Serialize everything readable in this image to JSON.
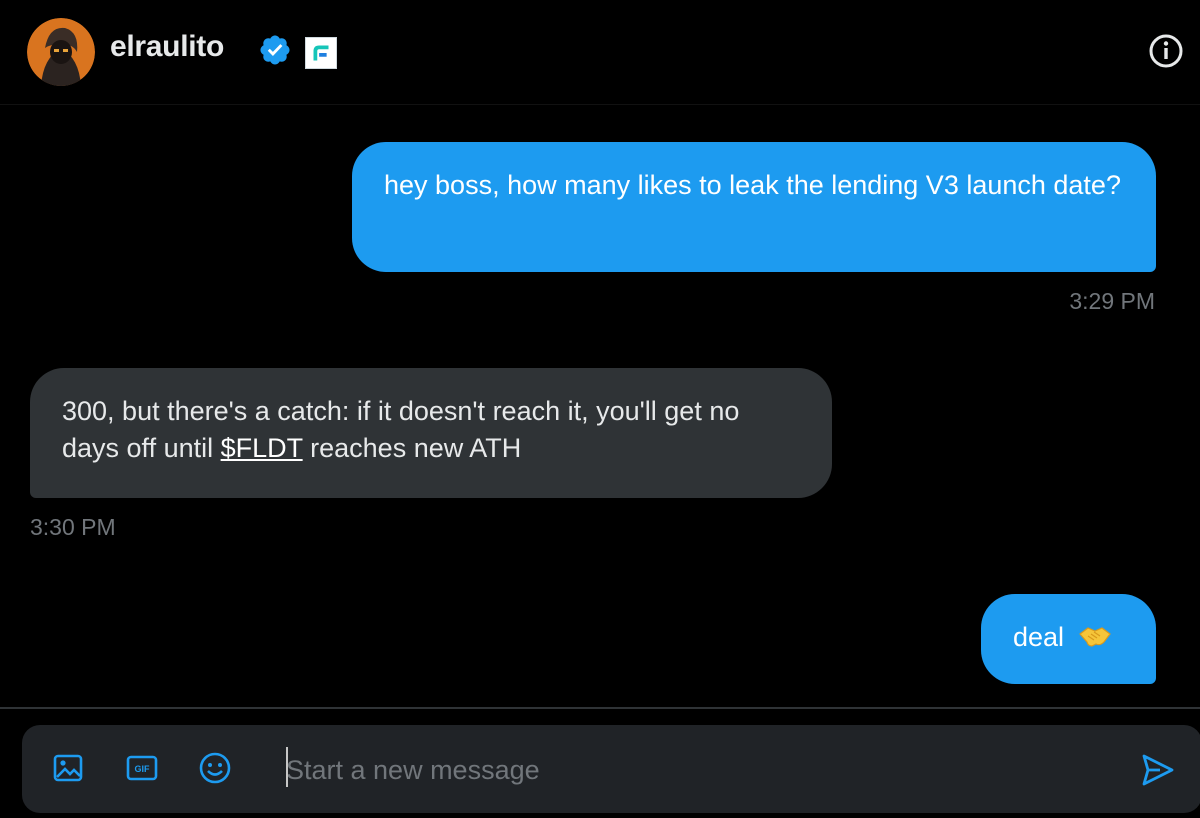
{
  "header": {
    "username": "elraulito"
  },
  "messages": [
    {
      "direction": "sent",
      "text": "hey boss, how many likes to leak the lending V3 launch date?",
      "time": "3:29 PM"
    },
    {
      "direction": "received",
      "text_before": "300, but there's a catch:  if it doesn't reach it, you'll get no days off until ",
      "cashtag": "$FLDT",
      "text_after": " reaches new ATH",
      "time": "3:30 PM"
    },
    {
      "direction": "sent",
      "text": "deal",
      "emoji": "handshake-emoji"
    }
  ],
  "composer": {
    "placeholder": "Start a new message",
    "icons": [
      "image-icon",
      "gif-icon",
      "emoji-icon",
      "send-icon"
    ]
  },
  "colors": {
    "background": "#000000",
    "sent_bubble": "#1d9bf0",
    "received_bubble": "#2f3336",
    "timestamp": "#71767b",
    "accent": "#1d9bf0",
    "composer": "#202327"
  }
}
